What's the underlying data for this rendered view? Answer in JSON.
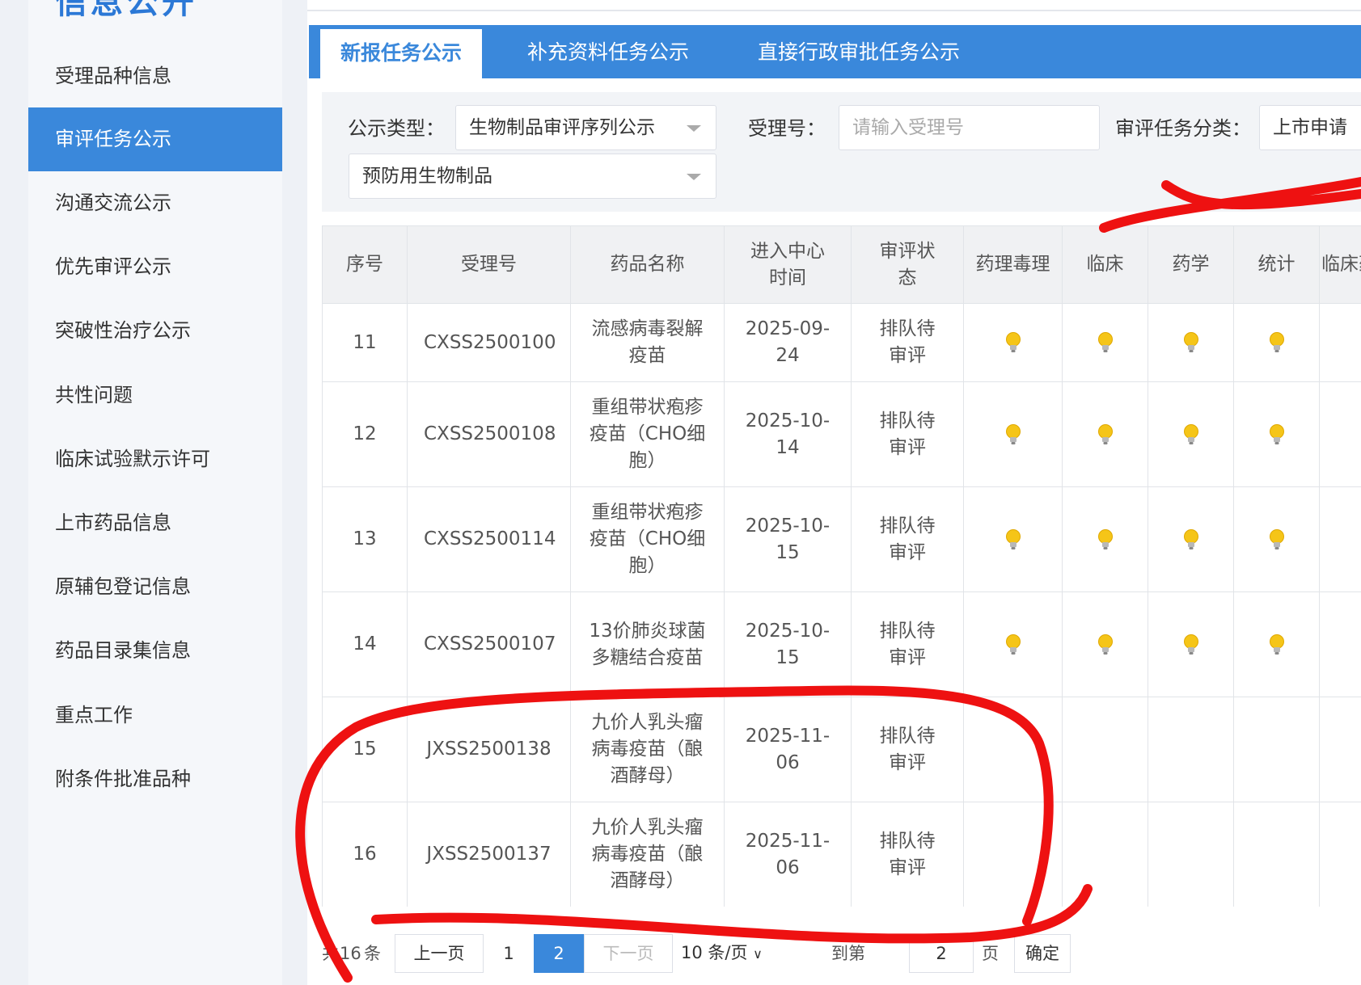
{
  "sidebar": {
    "title": "信息公开",
    "items": [
      {
        "label": "受理品种信息"
      },
      {
        "label": "审评任务公示"
      },
      {
        "label": "沟通交流公示"
      },
      {
        "label": "优先审评公示"
      },
      {
        "label": "突破性治疗公示"
      },
      {
        "label": "共性问题"
      },
      {
        "label": "临床试验默示许可"
      },
      {
        "label": "上市药品信息"
      },
      {
        "label": "原辅包登记信息"
      },
      {
        "label": "药品目录集信息"
      },
      {
        "label": "重点工作"
      },
      {
        "label": "附条件批准品种"
      }
    ],
    "active_index": 1
  },
  "tabs": [
    {
      "label": "新报任务公示"
    },
    {
      "label": "补充资料任务公示"
    },
    {
      "label": "直接行政审批任务公示"
    }
  ],
  "filters": {
    "type_label": "公示类型：",
    "type_value": "生物制品审评序列公示",
    "subtype_value": "预防用生物制品",
    "accept_no_label": "受理号：",
    "accept_no_placeholder": "请输入受理号",
    "category_label": "审评任务分类：",
    "category_value": "上市申请"
  },
  "table": {
    "headers": [
      "序号",
      "受理号",
      "药品名称",
      "进入中心时间",
      "审评状态",
      "药理毒理",
      "临床",
      "药学",
      "统计",
      "临床药理"
    ],
    "rows": [
      {
        "no": "11",
        "accept_no": "CXSS2500100",
        "name": "流感病毒裂解疫苗",
        "date": "2025-09-24",
        "status": "排队待审评",
        "has_icons": true
      },
      {
        "no": "12",
        "accept_no": "CXSS2500108",
        "name": "重组带状疱疹疫苗（CHO细胞）",
        "date": "2025-10-14",
        "status": "排队待审评",
        "has_icons": true
      },
      {
        "no": "13",
        "accept_no": "CXSS2500114",
        "name": "重组带状疱疹疫苗（CHO细胞）",
        "date": "2025-10-15",
        "status": "排队待审评",
        "has_icons": true
      },
      {
        "no": "14",
        "accept_no": "CXSS2500107",
        "name": "13价肺炎球菌多糖结合疫苗",
        "date": "2025-10-15",
        "status": "排队待审评",
        "has_icons": true
      },
      {
        "no": "15",
        "accept_no": "JXSS2500138",
        "name": "九价人乳头瘤病毒疫苗（酿酒酵母）",
        "date": "2025-11-06",
        "status": "排队待审评",
        "has_icons": false
      },
      {
        "no": "16",
        "accept_no": "JXSS2500137",
        "name": "九价人乳头瘤病毒疫苗（酿酒酵母）",
        "date": "2025-11-06",
        "status": "排队待审评",
        "has_icons": false
      }
    ]
  },
  "pagination": {
    "total_prefix": "共",
    "total_value": "16",
    "total_suffix": "条",
    "prev": "上一页",
    "pages": [
      "1",
      "2"
    ],
    "current": "2",
    "next": "下一页",
    "page_size": "10 条/页",
    "goto_prefix": "到第",
    "goto_value": "2",
    "goto_suffix": "页",
    "confirm": "确定"
  },
  "colors": {
    "accent": "#3a88db",
    "annotation": "#ee1111",
    "bulb": "#f5c518"
  }
}
